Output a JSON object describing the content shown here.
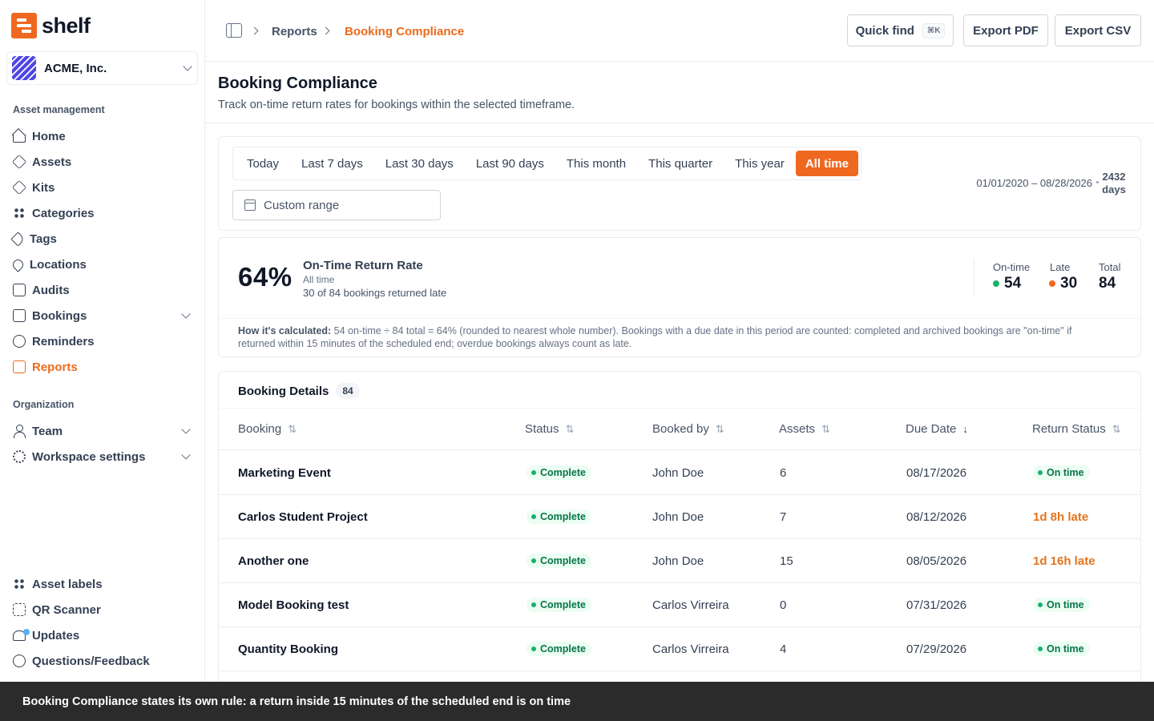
{
  "brand": {
    "name": "shelf",
    "accent": "#ef6820"
  },
  "workspace": {
    "name": "ACME, Inc."
  },
  "sidebar": {
    "section_asset": "Asset management",
    "asset_items": [
      {
        "label": "Home",
        "icon": "home-icon"
      },
      {
        "label": "Assets",
        "icon": "assets-icon"
      },
      {
        "label": "Kits",
        "icon": "kits-icon"
      },
      {
        "label": "Categories",
        "icon": "categories-icon"
      },
      {
        "label": "Tags",
        "icon": "tag-icon"
      },
      {
        "label": "Locations",
        "icon": "location-pin-icon"
      },
      {
        "label": "Audits",
        "icon": "clipboard-icon"
      },
      {
        "label": "Bookings",
        "icon": "calendar-icon"
      },
      {
        "label": "Reminders",
        "icon": "alarm-icon"
      },
      {
        "label": "Reports",
        "icon": "report-icon"
      }
    ],
    "section_org": "Organization",
    "org_items": [
      {
        "label": "Team",
        "icon": "person-icon"
      },
      {
        "label": "Workspace settings",
        "icon": "gear-icon"
      }
    ],
    "bottom_items": [
      {
        "label": "Asset labels",
        "icon": "qr-grid-icon"
      },
      {
        "label": "QR Scanner",
        "icon": "scan-icon"
      },
      {
        "label": "Updates",
        "icon": "bell-icon"
      },
      {
        "label": "Questions/Feedback",
        "icon": "message-icon"
      }
    ]
  },
  "topbar": {
    "crumb_parent": "Reports",
    "crumb_current": "Booking Compliance",
    "quick_find": "Quick find",
    "quick_find_kbd": "⌘K",
    "export_pdf": "Export PDF",
    "export_csv": "Export CSV"
  },
  "header": {
    "title": "Booking Compliance",
    "subtitle": "Track on-time return rates for bookings within the selected timeframe."
  },
  "timeframe": {
    "options": [
      "Today",
      "Last 7 days",
      "Last 30 days",
      "Last 90 days",
      "This month",
      "This quarter",
      "This year",
      "All time"
    ],
    "selected": "All time",
    "custom_range_placeholder": "Custom range",
    "range": "01/01/2020 – 08/28/2026",
    "days_value": "2432",
    "days_unit": "days"
  },
  "kpi": {
    "rate": "64%",
    "title": "On-Time Return Rate",
    "period": "All time",
    "detail": "30 of 84 bookings returned late",
    "ontime_label": "On-time",
    "ontime_value": "54",
    "late_label": "Late",
    "late_value": "30",
    "total_label": "Total",
    "total_value": "84",
    "calc_label": "How it's calculated:",
    "calc_text": " 54 on-time ÷ 84 total = 64% (rounded to nearest whole number). Bookings with a due date in this period are counted: completed and archived bookings are \"on-time\" if returned within 15 minutes of the scheduled end; overdue bookings always count as late.",
    "colors": {
      "ontime": "#17b26a",
      "late": "#ef6820"
    }
  },
  "table": {
    "title": "Booking Details",
    "count": "84",
    "columns": [
      "Booking",
      "Status",
      "Booked by",
      "Assets",
      "Due Date",
      "Return Status"
    ],
    "rows": [
      {
        "booking": "Marketing Event",
        "status": "Complete",
        "booked_by": "John Doe",
        "assets": "6",
        "due": "08/17/2026",
        "return": "On time",
        "late": false
      },
      {
        "booking": "Carlos Student Project",
        "status": "Complete",
        "booked_by": "John Doe",
        "assets": "7",
        "due": "08/12/2026",
        "return": "1d 8h late",
        "late": true
      },
      {
        "booking": "Another one",
        "status": "Complete",
        "booked_by": "John Doe",
        "assets": "15",
        "due": "08/05/2026",
        "return": "1d 16h late",
        "late": true
      },
      {
        "booking": "Model Booking test",
        "status": "Complete",
        "booked_by": "Carlos Virreira",
        "assets": "0",
        "due": "07/31/2026",
        "return": "On time",
        "late": false
      },
      {
        "booking": "Quantity Booking",
        "status": "Complete",
        "booked_by": "Carlos Virreira",
        "assets": "4",
        "due": "07/29/2026",
        "return": "On time",
        "late": false
      }
    ]
  },
  "caption": "Booking Compliance states its own rule: a return inside 15 minutes of the scheduled end is on time"
}
